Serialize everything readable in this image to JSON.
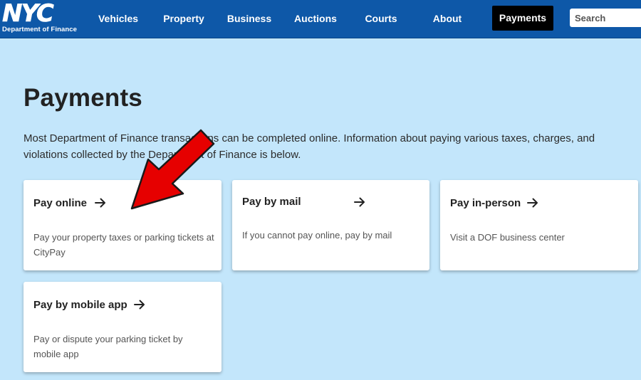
{
  "header": {
    "logo_word": "NYC",
    "logo_subtitle": "Department of Finance",
    "nav": {
      "vehicles": "Vehicles",
      "property": "Property",
      "business": "Business",
      "auctions": "Auctions",
      "courts": "Courts",
      "about": "About",
      "payments": "Payments"
    },
    "search_placeholder": "Search"
  },
  "main": {
    "title": "Payments",
    "intro": "Most Department of Finance transactions can be completed online. Information about paying various taxes, charges, and violations collected by the Department of Finance is below.",
    "cards": [
      {
        "title": "Pay online",
        "description": "Pay your property taxes or parking tickets at CityPay"
      },
      {
        "title": "Pay by mail",
        "description": "If you cannot pay online, pay by mail"
      },
      {
        "title": "Pay in-person",
        "description": "Visit a DOF business center"
      },
      {
        "title": "Pay by mobile app",
        "description": "Pay or dispute your parking ticket by mobile app"
      }
    ]
  },
  "annotation": {
    "arrow_color": "#e60000",
    "arrow_target": "Pay online card"
  },
  "colors": {
    "header_bg": "#0e58a8",
    "page_bg": "#c3e6fb",
    "active_nav_bg": "#000000"
  }
}
